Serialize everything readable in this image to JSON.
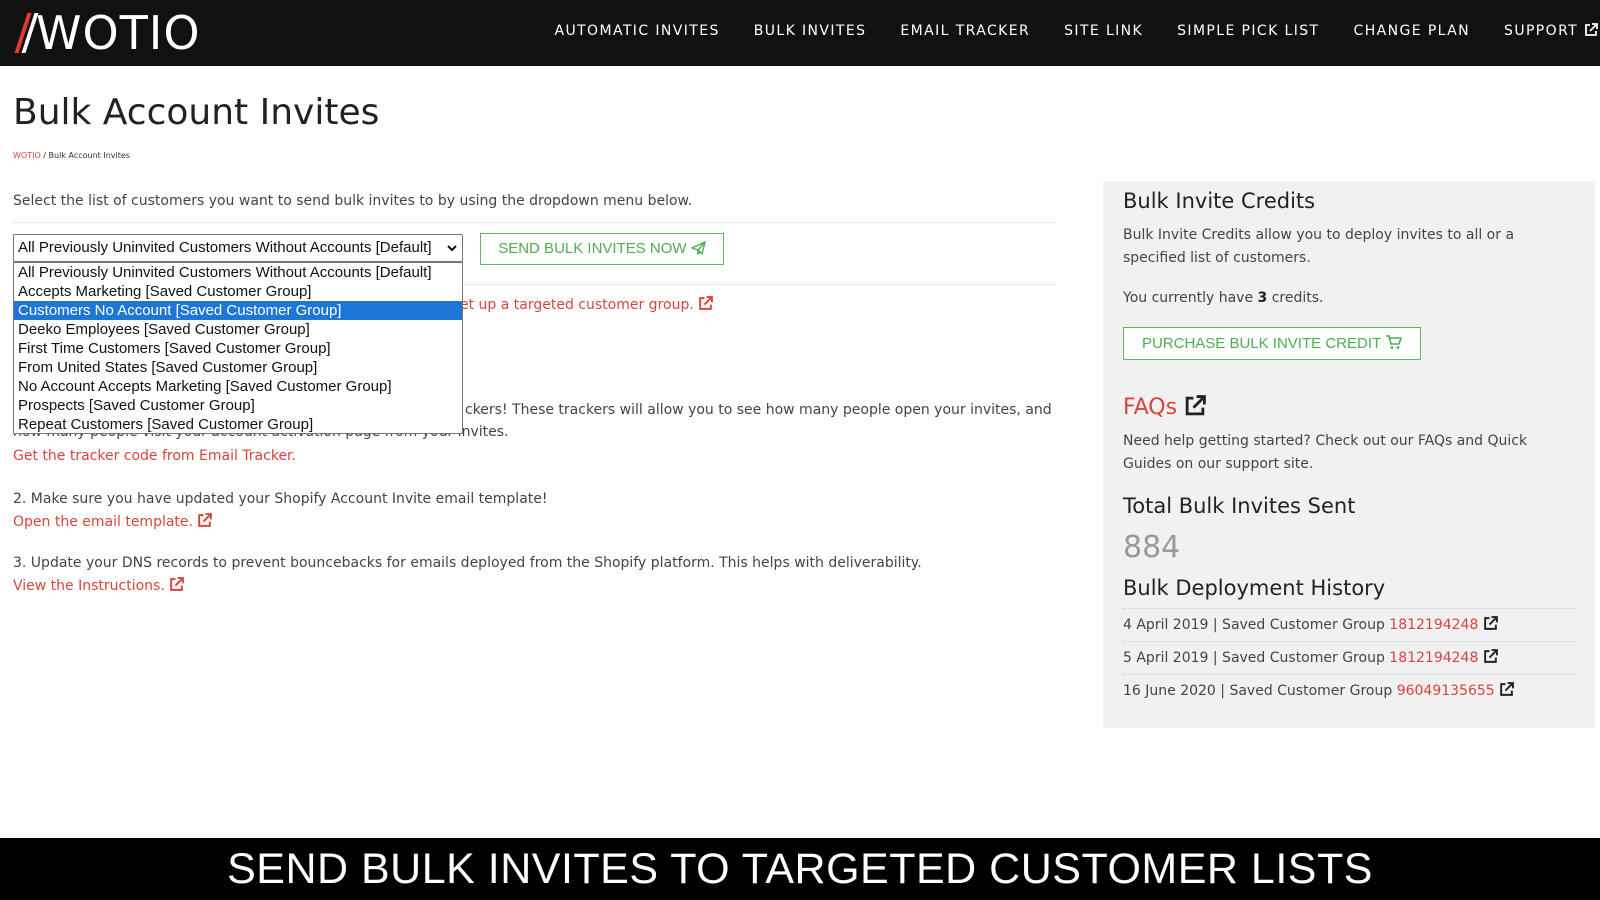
{
  "header": {
    "logo": "WOTIO",
    "nav": [
      "AUTOMATIC INVITES",
      "BULK INVITES",
      "EMAIL TRACKER",
      "SITE LINK",
      "SIMPLE PICK LIST",
      "CHANGE PLAN",
      "SUPPORT"
    ]
  },
  "main": {
    "title": "Bulk Account Invites",
    "breadcrumb": {
      "home": "WOTIO",
      "sep": " / ",
      "current": "Bulk Account Invites"
    },
    "intro": "Select the list of customers you want to send bulk invites to by using the dropdown menu below.",
    "select": {
      "selected": "All Previously Uninvited Customers Without Accounts [Default]",
      "options": [
        "All Previously Uninvited Customers Without Accounts [Default]",
        "Accepts Marketing [Saved Customer Group]",
        "Customers No Account [Saved Customer Group]",
        "Deeko Employees [Saved Customer Group]",
        "First Time Customers [Saved Customer Group]",
        "From United States [Saved Customer Group]",
        "No Account Accepts Marketing [Saved Customer Group]",
        "Prospects [Saved Customer Group]",
        "Repeat Customers [Saved Customer Group]"
      ],
      "highlighted_index": 2
    },
    "send_button": "SEND BULK INVITES NOW",
    "targeted_link": "et up a targeted customer group.",
    "trackers_line1": "ckers! These trackers will allow you to see how many people open your invites, and",
    "trackers_line2": "how many people visit your account activation page from your invites.",
    "tracker_link": "Get the tracker code from Email Tracker.",
    "step2": "2. Make sure you have updated your Shopify Account Invite email template!",
    "step2_link": "Open the email template.",
    "step3": "3. Update your DNS records to prevent bouncebacks for emails deployed from the Shopify platform. This helps with deliverability.",
    "step3_link": "View the Instructions."
  },
  "sidebar": {
    "credits_title": "Bulk Invite Credits",
    "credits_desc": "Bulk Invite Credits allow you to deploy invites to all or a specified list of customers.",
    "credits_prefix": "You currently have ",
    "credits_count": "3",
    "credits_suffix": " credits.",
    "purchase_button": "PURCHASE BULK INVITE CREDIT",
    "faq_title": "FAQs",
    "faq_desc": "Need help getting started? Check out our FAQs and Quick Guides on our support site.",
    "total_title": "Total Bulk Invites Sent",
    "total_count": "884",
    "history_title": "Bulk Deployment History",
    "history": [
      {
        "text": "4 April 2019 | Saved Customer Group ",
        "id": "1812194248"
      },
      {
        "text": "5 April 2019 | Saved Customer Group ",
        "id": "1812194248"
      },
      {
        "text": "16 June 2020 | Saved Customer Group ",
        "id": "96049135655"
      }
    ]
  },
  "caption": "SEND BULK INVITES TO TARGETED CUSTOMER LISTS",
  "colors": {
    "accent_red": "#d9443c",
    "green": "#4caf50",
    "highlight_blue": "#1e77d6"
  },
  "icons": [
    "external-link-icon",
    "paper-plane-icon",
    "cart-icon",
    "chevron-down-icon"
  ]
}
